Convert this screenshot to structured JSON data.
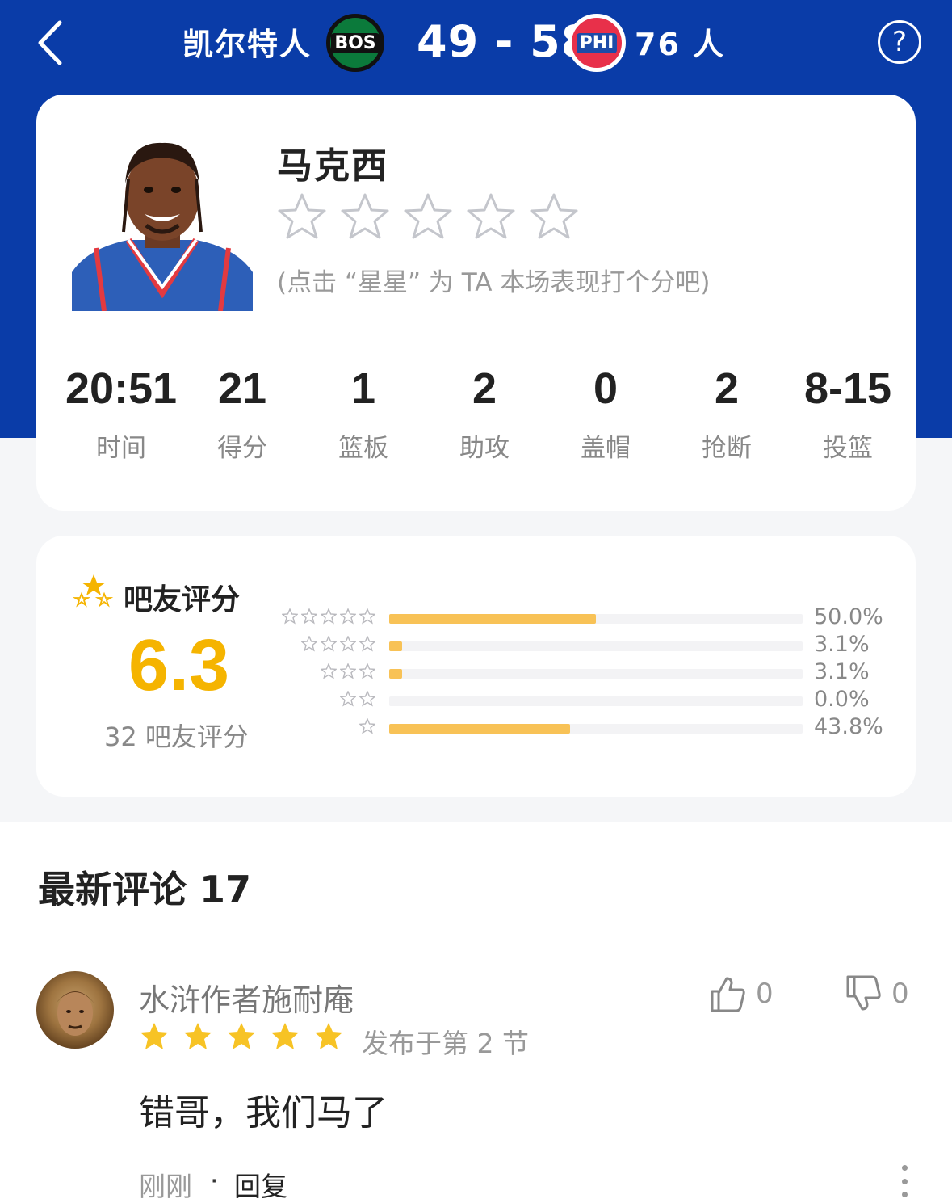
{
  "header": {
    "home_team": "凯尔特人",
    "home_logo_text": "BOS",
    "score": "49 - 58",
    "away_logo_text": "PHI",
    "away_team": "76 人",
    "help_icon": "?"
  },
  "player": {
    "name": "马克西",
    "rate_hint": "(点击 “星星” 为 TA 本场表现打个分吧)",
    "stats": [
      {
        "value": "20:51",
        "label": "时间"
      },
      {
        "value": "21",
        "label": "得分"
      },
      {
        "value": "1",
        "label": "篮板"
      },
      {
        "value": "2",
        "label": "助攻"
      },
      {
        "value": "0",
        "label": "盖帽"
      },
      {
        "value": "2",
        "label": "抢断"
      },
      {
        "value": "8-15",
        "label": "投篮"
      }
    ]
  },
  "rating": {
    "title": "吧友评分",
    "score": "6.3",
    "count_label": "32 吧友评分",
    "distribution": [
      {
        "stars": 5,
        "fraction": 0.5,
        "pct": "50.0%"
      },
      {
        "stars": 4,
        "fraction": 0.031,
        "pct": "3.1%"
      },
      {
        "stars": 3,
        "fraction": 0.031,
        "pct": "3.1%"
      },
      {
        "stars": 2,
        "fraction": 0.0,
        "pct": "0.0%"
      },
      {
        "stars": 1,
        "fraction": 0.438,
        "pct": "43.8%"
      }
    ]
  },
  "comments": {
    "title": "最新评论 17",
    "items": [
      {
        "user": "水浒作者施耐庵",
        "stars": 5,
        "posted": "发布于第 2 节",
        "likes": "0",
        "dislikes": "0",
        "text": "错哥，我们马了",
        "time": "刚刚",
        "separator": "·",
        "reply": "回复"
      }
    ]
  },
  "colors": {
    "header_blue": "#0a3ca8",
    "score_gold": "#f5b400",
    "bar_fill": "#f8c256"
  }
}
